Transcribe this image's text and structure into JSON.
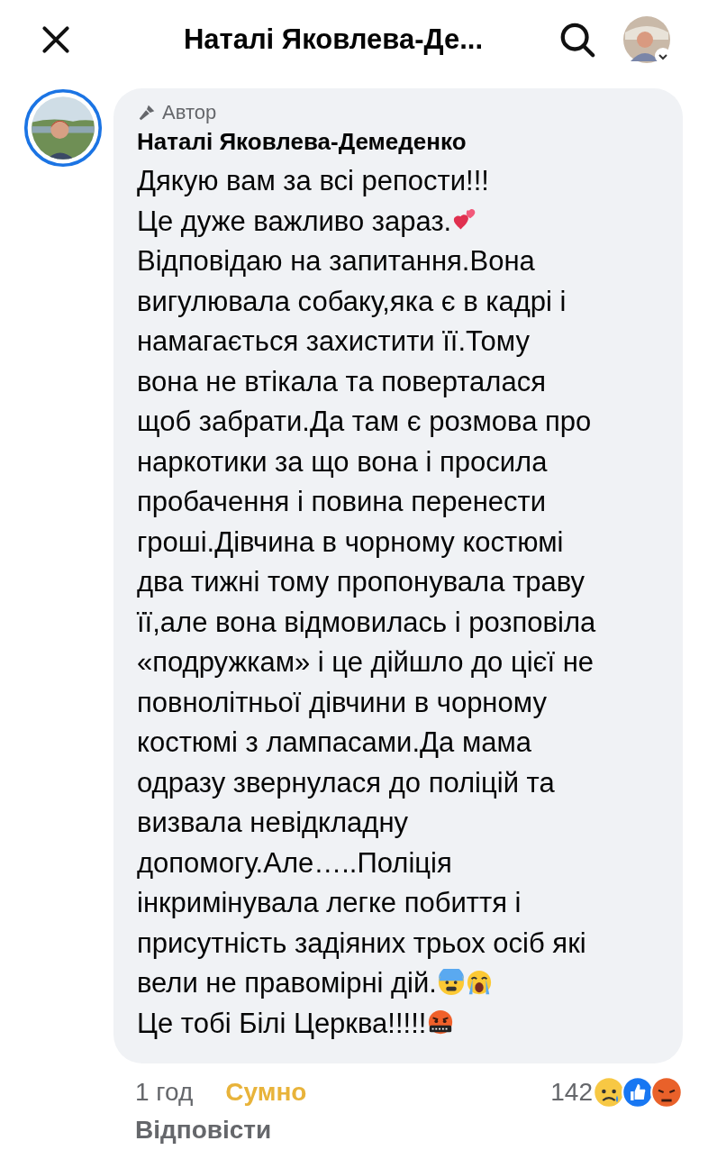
{
  "header": {
    "title": "Наталі Яковлева-Де..."
  },
  "comment": {
    "badge": "Автор",
    "author": "Наталі Яковлева-Демеденко",
    "lines": [
      {
        "text": "Дякую вам за всі репости!!!"
      },
      {
        "text": "Це дуже важливо зараз.",
        "emoji": [
          {
            "kind": "hearts"
          }
        ]
      },
      {
        "text": "Відповідаю на запитання.Вона"
      },
      {
        "text": "вигулювала собаку,яка є в кадрі і"
      },
      {
        "text": "намагається захистити її.Тому"
      },
      {
        "text": "вона не втікала та поверталася"
      },
      {
        "text": "щоб забрати.Да там є розмова про"
      },
      {
        "text": "наркотики за що вона і просила"
      },
      {
        "text": "пробачення і повина перенести"
      },
      {
        "text": "гроші.Дівчина в чорному костюмі"
      },
      {
        "text": "два тижні тому пропонувала траву"
      },
      {
        "text": "її,але вона відмовилась і розповіла"
      },
      {
        "text": "«подружкам» і це дійшло до цієї не"
      },
      {
        "text": "повнолітньої дівчини в чорному"
      },
      {
        "text": "костюмі з лампасами.Да мама"
      },
      {
        "text": "одразу звернулася до поліцій та"
      },
      {
        "text": "визвала невідкладну"
      },
      {
        "text": "допомогу.Але…..Поліція"
      },
      {
        "text": "інкримінувала легке побиття і"
      },
      {
        "text": "присутність задіяних трьох осіб які"
      },
      {
        "text": "вели не правомірні дій.",
        "emoji": [
          {
            "kind": "anxious"
          },
          {
            "kind": "crying"
          }
        ]
      },
      {
        "text": "Це тобі Білі Церква!!!!!",
        "emoji": [
          {
            "kind": "cursing"
          }
        ]
      }
    ],
    "time": "1 год",
    "my_reaction": "Сумно",
    "reaction_count": "142",
    "reactions": [
      {
        "kind": "sad"
      },
      {
        "kind": "like"
      },
      {
        "kind": "angry"
      }
    ],
    "reply": "Відповісти"
  }
}
